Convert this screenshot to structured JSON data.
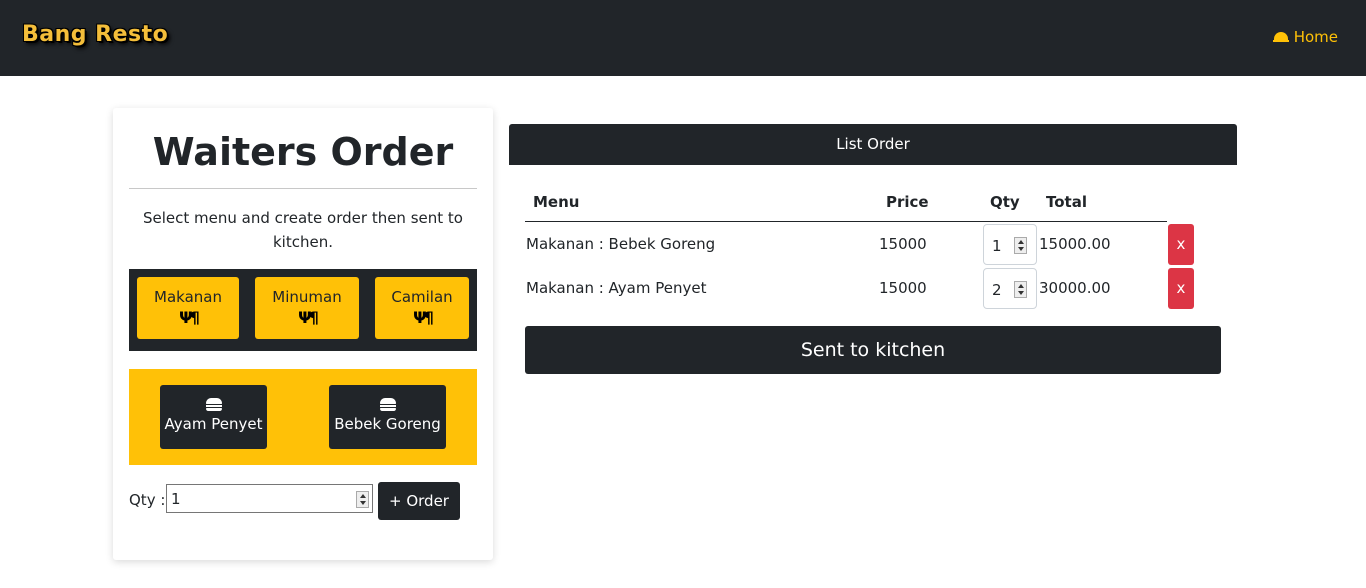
{
  "navbar": {
    "brand": "Bang Resto",
    "home_icon": "bell-icon",
    "home_label": "Home"
  },
  "waiter_card": {
    "title": "Waiters Order",
    "description": "Select menu and create order then sent to kitchen.",
    "categories": [
      {
        "label": "Makanan",
        "icon": "utensils-icon",
        "glyph": "Ψ¶"
      },
      {
        "label": "Minuman",
        "icon": "utensils-icon",
        "glyph": "Ψ¶"
      },
      {
        "label": "Camilan",
        "icon": "utensils-icon",
        "glyph": "Ψ¶"
      }
    ],
    "menu_items": [
      {
        "label": "Ayam Penyet",
        "icon": "hamburger-icon"
      },
      {
        "label": "Bebek Goreng",
        "icon": "hamburger-icon"
      }
    ],
    "qty_label": "Qty :",
    "qty_value": "1",
    "order_button": "+ Order"
  },
  "order_list": {
    "header": "List Order",
    "columns": [
      "Menu",
      "Price",
      "Qty",
      "Total"
    ],
    "rows": [
      {
        "menu": "Makanan : Bebek Goreng",
        "price": "15000",
        "qty": "1",
        "total": "15000.00",
        "delete": "x"
      },
      {
        "menu": "Makanan : Ayam Penyet",
        "price": "15000",
        "qty": "2",
        "total": "30000.00",
        "delete": "x"
      }
    ],
    "send_button": "Sent to kitchen"
  },
  "colors": {
    "dark": "#212529",
    "accent": "#ffc107",
    "danger": "#dc3545"
  }
}
